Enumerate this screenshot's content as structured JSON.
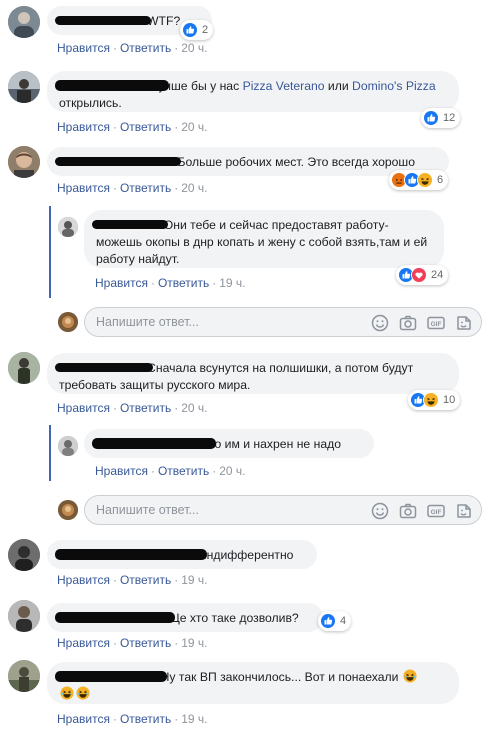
{
  "labels": {
    "like": "Нравится",
    "reply": "Ответить",
    "dot": "·",
    "reply_placeholder": "Напишите ответ..."
  },
  "comments": [
    {
      "text": "WTF?",
      "time": "20 ч.",
      "reactions": [
        "like"
      ],
      "count": "2"
    },
    {
      "text_pre": "Лучше бы у нас ",
      "link1": "Pizza Veterano",
      "mid": " или ",
      "link2": "Domino's Pizza",
      "post": " открылись.",
      "time": "20 ч.",
      "reactions": [
        "like"
      ],
      "count": "12"
    },
    {
      "text": "Больше робочих мест. Это всегда хорошо",
      "time": "20 ч.",
      "reactions": [
        "angry",
        "like",
        "haha"
      ],
      "count": "6"
    },
    {
      "text": "Они тебе и сейчас предоставят работу- можешь окопы в днр копать и жену с собой взять,там и ей работу найдут.",
      "time": "19 ч.",
      "reactions": [
        "like",
        "love"
      ],
      "count": "24"
    },
    {
      "text": "Сначала всунутся на полшишки, а потом будут требовать защиты русского мира.",
      "time": "20 ч.",
      "reactions": [
        "like",
        "haha"
      ],
      "count": "10"
    },
    {
      "text": "оно им и нахрен не надо",
      "time": "20 ч."
    },
    {
      "text": "Индифферентно",
      "time": "19 ч."
    },
    {
      "text": "Це хто таке дозволив?",
      "time": "19 ч.",
      "reactions": [
        "like"
      ],
      "count": "4"
    },
    {
      "text": "Ну так ВП закончилось... Вот и понаехали",
      "time": "19 ч.",
      "emoji_count": 3
    }
  ],
  "colors": {
    "link": "#385898",
    "bubble": "#f2f3f5",
    "like": "#1877f2",
    "haha": "#f7b125",
    "angry": "#e9710f",
    "love": "#f33e58",
    "thread_line": "#4267b2"
  },
  "icons": [
    "emoji-icon",
    "camera-icon",
    "gif-icon",
    "sticker-icon"
  ]
}
